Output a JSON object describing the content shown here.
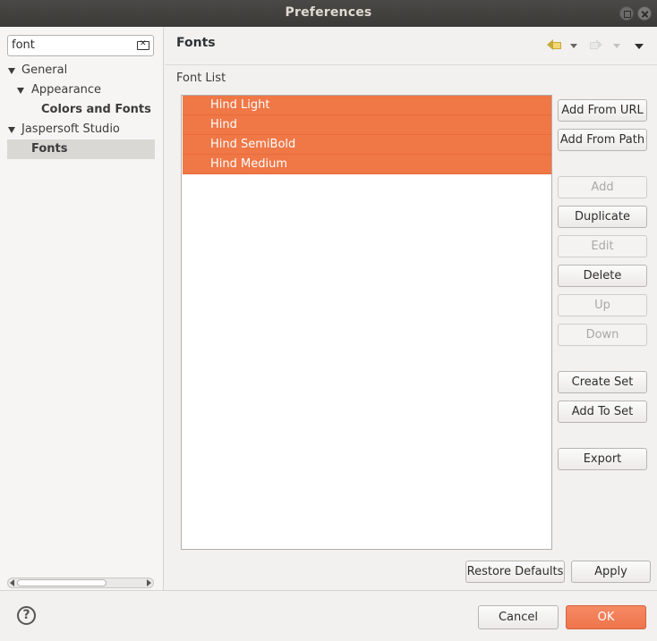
{
  "window": {
    "title": "Preferences"
  },
  "search": {
    "value": "font"
  },
  "tree": [
    {
      "label": "General"
    },
    {
      "label": "Appearance"
    },
    {
      "label": "Colors and Fonts"
    },
    {
      "label": "Jaspersoft Studio"
    },
    {
      "label": "Fonts"
    }
  ],
  "page": {
    "title": "Fonts",
    "section_label": "Font List"
  },
  "fonts": [
    "Hind Light",
    "Hind",
    "Hind SemiBold",
    "Hind Medium"
  ],
  "buttons": {
    "add_from_url": "Add From URL",
    "add_from_path": "Add From Path",
    "add": "Add",
    "duplicate": "Duplicate",
    "edit": "Edit",
    "delete": "Delete",
    "up": "Up",
    "down": "Down",
    "create_set": "Create Set",
    "add_to_set": "Add To Set",
    "export": "Export",
    "restore_defaults": "Restore Defaults",
    "apply": "Apply",
    "cancel": "Cancel",
    "ok": "OK"
  },
  "icons": {
    "back": "back-arrow-icon",
    "forward": "forward-arrow-icon",
    "menu": "view-menu-icon",
    "help": "help-icon",
    "help_glyph": "?"
  },
  "colors": {
    "selection": "#f07746",
    "ok_button": "#ef744b"
  }
}
